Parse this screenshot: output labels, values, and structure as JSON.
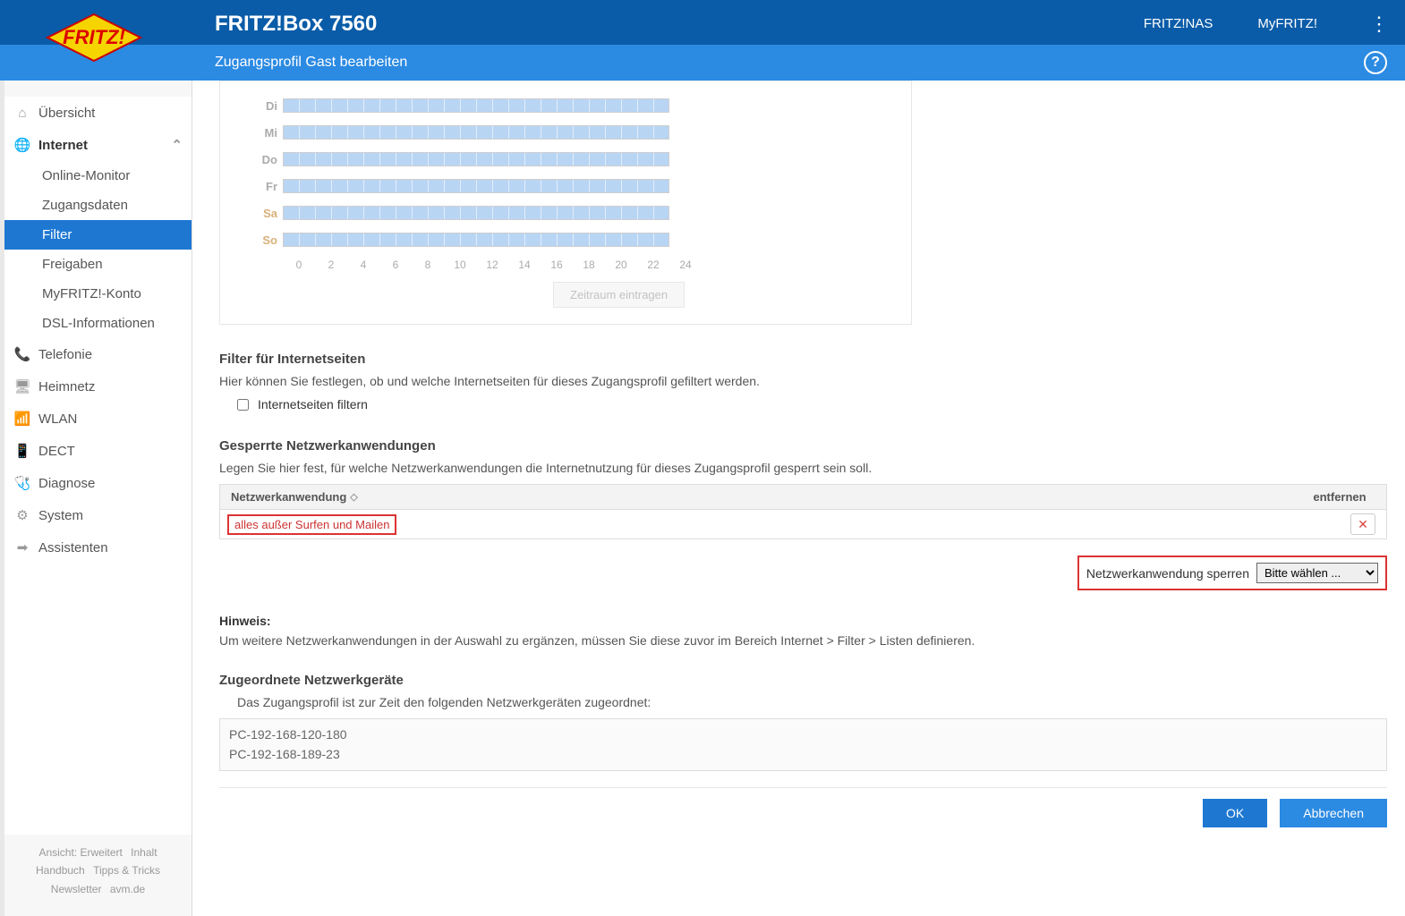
{
  "header": {
    "title": "FRITZ!Box 7560",
    "links": [
      "FRITZ!NAS",
      "MyFRITZ!"
    ]
  },
  "subheader": {
    "title": "Zugangsprofil Gast bearbeiten"
  },
  "sidebar": {
    "items": [
      {
        "label": "Übersicht",
        "icon": "home"
      },
      {
        "label": "Internet",
        "icon": "globe",
        "expanded": true
      },
      {
        "label": "Telefonie",
        "icon": "phone"
      },
      {
        "label": "Heimnetz",
        "icon": "devices"
      },
      {
        "label": "WLAN",
        "icon": "wifi"
      },
      {
        "label": "DECT",
        "icon": "dect"
      },
      {
        "label": "Diagnose",
        "icon": "diag"
      },
      {
        "label": "System",
        "icon": "gear"
      },
      {
        "label": "Assistenten",
        "icon": "wizard"
      }
    ],
    "subitems": [
      "Online-Monitor",
      "Zugangsdaten",
      "Filter",
      "Freigaben",
      "MyFRITZ!-Konto",
      "DSL-Informationen"
    ],
    "active_sub": "Filter",
    "footer": [
      "Ansicht: Erweitert",
      "Inhalt",
      "Handbuch",
      "Tipps & Tricks",
      "Newsletter",
      "avm.de"
    ]
  },
  "schedule": {
    "days": [
      "Di",
      "Mi",
      "Do",
      "Fr",
      "Sa",
      "So"
    ],
    "weekend": [
      "Sa",
      "So"
    ],
    "axis": [
      "0",
      "2",
      "4",
      "6",
      "8",
      "10",
      "12",
      "14",
      "16",
      "18",
      "20",
      "22",
      "24"
    ],
    "button": "Zeitraum eintragen"
  },
  "filter_section": {
    "title": "Filter für Internetseiten",
    "desc": "Hier können Sie festlegen, ob und welche Internetseiten für dieses Zugangsprofil gefiltert werden.",
    "checkbox": "Internetseiten filtern"
  },
  "block_section": {
    "title": "Gesperrte Netzwerkanwendungen",
    "desc": "Legen Sie hier fest, für welche Netzwerkanwendungen die Internetnutzung für dieses Zugangsprofil gesperrt sein soll.",
    "col1": "Netzwerkanwendung",
    "col2": "entfernen",
    "row": "alles außer Surfen und Mailen",
    "lock_label": "Netzwerkanwendung sperren",
    "lock_select": "Bitte wählen ..."
  },
  "hint": {
    "title": "Hinweis:",
    "text": "Um weitere Netzwerkanwendungen in der Auswahl zu ergänzen, müssen Sie diese zuvor im Bereich Internet > Filter > Listen definieren."
  },
  "devices": {
    "title": "Zugeordnete Netzwerkgeräte",
    "desc": "Das Zugangsprofil ist zur Zeit den folgenden Netzwerkgeräten zugeordnet:",
    "list": [
      "PC-192-168-120-180",
      "PC-192-168-189-23"
    ]
  },
  "buttons": {
    "ok": "OK",
    "cancel": "Abbrechen"
  }
}
